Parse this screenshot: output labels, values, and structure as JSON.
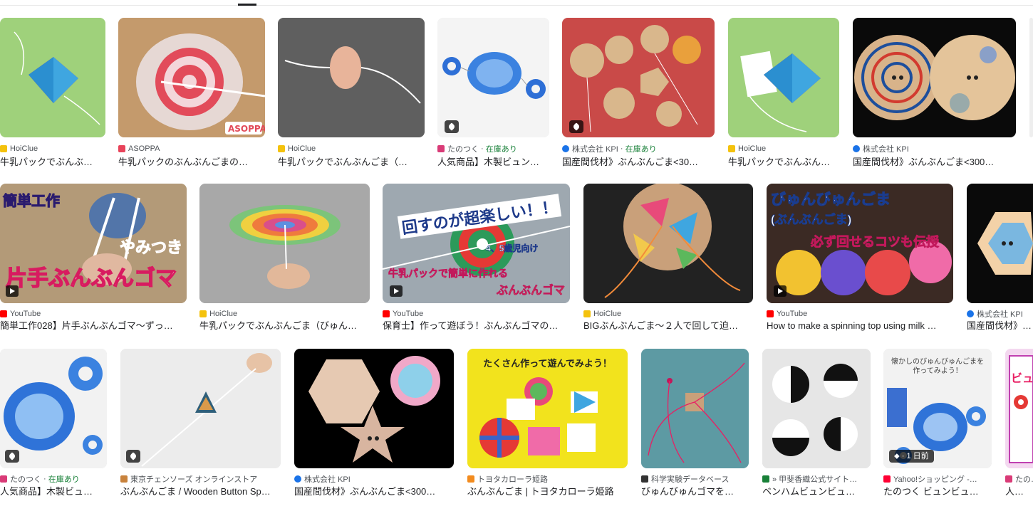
{
  "rows": [
    {
      "items": [
        {
          "source": "HoiClue",
          "title": "牛乳パックでぶんぶ…",
          "favicon_color": "#f4c20d",
          "thumb_bg": "#9fd17b"
        },
        {
          "source": "ASOPPA",
          "title": "牛乳パックのぶんぶんごまの…",
          "favicon_color": "#e8435a",
          "thumb_bg": "#c49a6c"
        },
        {
          "source": "HoiClue",
          "title": "牛乳パックでぶんぶんごま（…",
          "favicon_color": "#f4c20d",
          "thumb_bg": "#5f5f5f"
        },
        {
          "source": "たのつく",
          "stock": "在庫あり",
          "title": "人気商品】木製ビュン…",
          "favicon_color": "#d93b77",
          "thumb_bg": "#f4f4f4"
        },
        {
          "source": "株式会社 KPI",
          "stock": "在庫あり",
          "title": "国産間伐材》ぶんぶんごま<30…",
          "favicon_color": "#1a73e8",
          "thumb_bg": "#c94a48"
        },
        {
          "source": "HoiClue",
          "title": "牛乳パックでぶんぶん…",
          "favicon_color": "#f4c20d",
          "thumb_bg": "#9fd17b"
        },
        {
          "source": "株式会社 KPI",
          "title": "国産間伐材》ぶんぶんごま<300…",
          "favicon_color": "#1a73e8",
          "thumb_bg": "#0a0a0a"
        },
        {
          "source": "",
          "title": "",
          "favicon_color": "#dddddd",
          "thumb_bg": "#eeeeee"
        }
      ]
    },
    {
      "items": [
        {
          "source": "YouTube",
          "title": "簡単工作028】片手ぶんぶんゴマ〜ずっ…",
          "favicon_color": "#ff0000",
          "thumb_bg": "#b39a78",
          "overlay": [
            "簡単工作",
            "やみつき",
            "片手ぶんぶんゴマ"
          ]
        },
        {
          "source": "HoiClue",
          "title": "牛乳パックでぶんぶんごま（びゅん…",
          "favicon_color": "#f4c20d",
          "thumb_bg": "#a8a8a8"
        },
        {
          "source": "YouTube",
          "title": "保育士】作って遊ぼう！ぶんぶんゴマの…",
          "favicon_color": "#ff0000",
          "thumb_bg": "#9ea8b0",
          "overlay": [
            "回すのが超楽しい！！",
            "4、5歳児向け",
            "牛乳パックで簡単に作れる",
            "ぶんぶんゴマ"
          ]
        },
        {
          "source": "HoiClue",
          "title": "BIGぶんぶんごま〜２人で回して迫…",
          "favicon_color": "#f4c20d",
          "thumb_bg": "#222222"
        },
        {
          "source": "YouTube",
          "title": "How to make a spinning top using milk …",
          "favicon_color": "#ff0000",
          "thumb_bg": "#3b2a24",
          "overlay": [
            "びゅんびゅんごま",
            "(ぶんぶんごま)",
            "必ず回せるコツも伝授"
          ]
        },
        {
          "source": "株式会社 KPI",
          "title": "国産間伐材》ぶ…",
          "favicon_color": "#1a73e8",
          "thumb_bg": "#0a0a0a"
        }
      ]
    },
    {
      "items": [
        {
          "source": "たのつく",
          "stock": "在庫あり",
          "title": "人気商品】木製ビュ…",
          "favicon_color": "#d93b77",
          "thumb_bg": "#f2f2f2"
        },
        {
          "source": "東京チェンソーズ オンラインストア",
          "title": "ぶんぶんごま / Wooden Button Sp…",
          "favicon_color": "#c8823c",
          "thumb_bg": "#ececec"
        },
        {
          "source": "株式会社 KPI",
          "title": "国産間伐材》ぶんぶんごま<300…",
          "favicon_color": "#1a73e8",
          "thumb_bg": "#000000"
        },
        {
          "source": "トヨタカローラ姫路",
          "title": "ぶんぶんごま | トヨタカローラ姫路",
          "favicon_color": "#f28b1e",
          "thumb_bg": "#f2e31d",
          "overlay": [
            "たくさん作って遊んでみよう！"
          ]
        },
        {
          "source": "科学実験データベース",
          "title": "びゅんびゅんゴマを…",
          "favicon_color": "#333333",
          "thumb_bg": "#5d9aa3"
        },
        {
          "source": "» 甲斐香織公式サイト…",
          "title": "ベンハムビュンビュ…",
          "favicon_color": "#188038",
          "thumb_bg": "#e6e6e6"
        },
        {
          "source": "Yahoo!ショッピング -…",
          "title": "たのつく ビュンビュ…",
          "favicon_color": "#ff0033",
          "thumb_bg": "#f2f2f2",
          "badge": "1 日前",
          "overlay": [
            "懐かしのびゅんびゅんごまを",
            "作ってみよう！"
          ]
        },
        {
          "source": "たの…",
          "title": "人気商…",
          "favicon_color": "#d93b77",
          "thumb_bg": "#f4d8f0",
          "overlay": [
            "ビュ"
          ]
        }
      ]
    }
  ]
}
